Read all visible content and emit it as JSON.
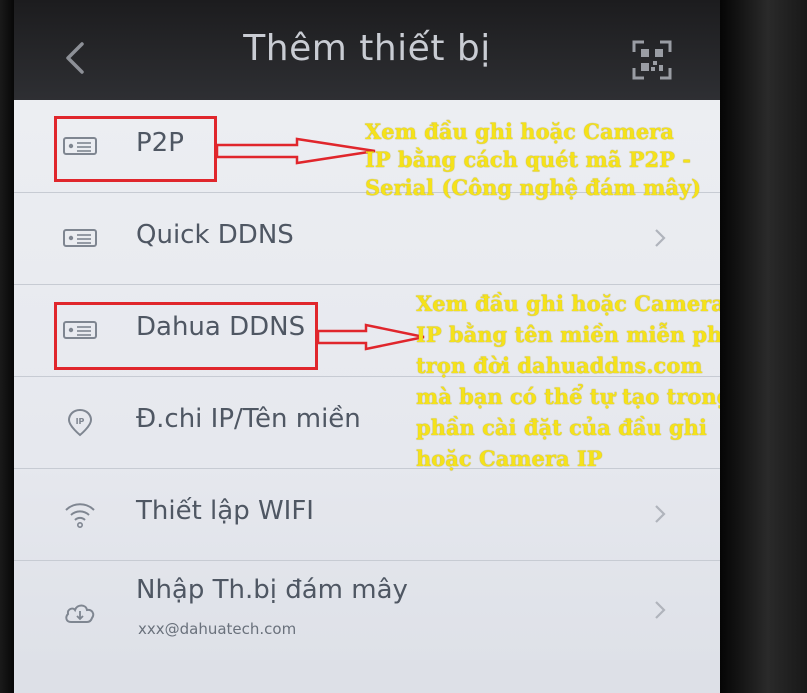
{
  "header": {
    "title": "Thêm thiết bị",
    "back_icon": "chevron-left-icon",
    "scan_icon": "qr-scan-icon"
  },
  "list": {
    "items": [
      {
        "label": "P2P",
        "icon": "dvr-icon",
        "has_chevron": false
      },
      {
        "label": "Quick DDNS",
        "icon": "dvr-icon",
        "has_chevron": true
      },
      {
        "label": "Dahua DDNS",
        "icon": "dvr-icon",
        "has_chevron": false
      },
      {
        "label": "Đ.chi IP/Tên miền",
        "icon": "ip-pin-icon",
        "has_chevron": false
      },
      {
        "label": "Thiết lập WIFI",
        "icon": "wifi-icon",
        "has_chevron": true
      },
      {
        "label": "Nhập Th.bị đám mây",
        "sublabel": "xxx@dahuatech.com",
        "icon": "cloud-download-icon",
        "has_chevron": true
      }
    ]
  },
  "annotations": {
    "p2p_note": [
      "Xem đầu ghi hoặc Camera",
      "IP bằng cách quét mã P2P -",
      "Serial (Công nghệ đám mây)"
    ],
    "ddns_note": [
      "Xem đầu ghi hoặc Camera",
      "IP bằng tên miền miễn phí",
      "trọn đời dahuaddns.com",
      "mà bạn có thể tự tạo trong",
      "phần cài đặt của đầu ghi",
      "hoặc Camera IP"
    ]
  },
  "colors": {
    "highlight_red": "#e0262c",
    "note_yellow": "#f5e21a",
    "navbar": "#1c1c1e",
    "list_bg": "#e7e9ee"
  }
}
